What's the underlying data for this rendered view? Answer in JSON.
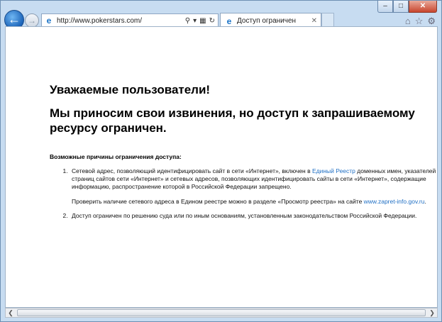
{
  "browser": {
    "url": "http://www.pokerstars.com/",
    "tab_title": "Доступ ограничен",
    "caption": {
      "minimize": "–",
      "maximize": "□",
      "close": "✕"
    },
    "icons": {
      "back": "←",
      "forward": "→",
      "ie": "e",
      "search": "⚲",
      "dropdown": "▾",
      "compat": "▦",
      "refresh": "↻",
      "tab_close": "✕",
      "home": "⌂",
      "favorites": "☆",
      "tools": "⚙"
    }
  },
  "page": {
    "heading1": "Уважаемые пользователи!",
    "heading2": "Мы приносим свои извинения, но доступ к запрашиваемому ресурсу ограничен.",
    "reasons_title": "Возможные причины ограничения доступа:",
    "reason1": {
      "part1": "Сетевой адрес, позволяющий идентифицировать сайт в сети «Интернет», включен в ",
      "link": "Единый Реестр",
      "part2": " доменных имен, указателей страниц сайтов сети «Интернет» и сетевых адресов, позволяющих идентифицировать сайты в сети «Интернет», содержащие информацию, распространение которой в Российской Федерации запрещено.",
      "check_text": "Проверить наличие сетевого адреса в Едином реестре можно в разделе «Просмотр реестра» на сайте ",
      "check_link": "www.zapret-info.gov.ru",
      "check_end": "."
    },
    "reason2": "Доступ ограничен  по решению суда или по иным основаниям, установленным законодательством Российской Федерации."
  },
  "scrollbar": {
    "left": "❮",
    "right": "❯"
  }
}
